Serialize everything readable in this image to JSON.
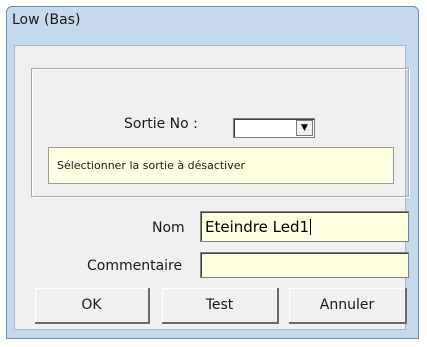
{
  "window": {
    "title": "Low (Bas)"
  },
  "output": {
    "label": "Sortie No :",
    "selected": "",
    "hint": "Sélectionner la sortie à désactiver"
  },
  "form": {
    "name_label": "Nom",
    "name_value": "Eteindre Led1",
    "comment_label": "Commentaire",
    "comment_value": ""
  },
  "buttons": {
    "ok": "OK",
    "test": "Test",
    "cancel": "Annuler"
  },
  "colors": {
    "titlebar": "#c5d8ec",
    "field_bg": "#ffffe1",
    "dialog_bg": "#f0f0f0"
  }
}
